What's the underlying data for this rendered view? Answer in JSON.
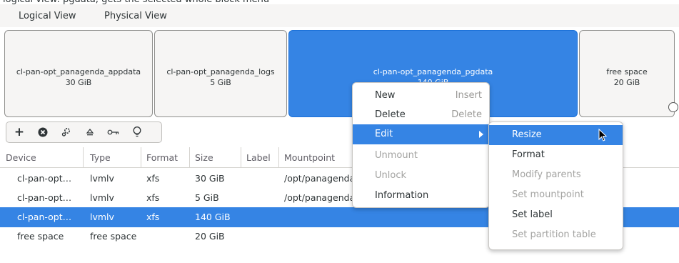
{
  "tabs": [
    {
      "label": "Logical View",
      "active": true
    },
    {
      "label": "Physical View",
      "active": false
    }
  ],
  "blocks": [
    {
      "name": "cl-pan-opt_panagenda_appdata",
      "size": "30 GiB"
    },
    {
      "name": "cl-pan-opt_panagenda_logs",
      "size": "5 GiB"
    },
    {
      "name": "cl-pan-opt_panagenda_pgdata",
      "size": "140 GiB"
    },
    {
      "name": "free space",
      "size": "20 GiB"
    }
  ],
  "toolbar": {
    "add": "+",
    "delete": "✖",
    "configure": "⚙",
    "eject": "⏏",
    "key": "⊶",
    "info": "♀"
  },
  "table": {
    "headers": [
      "Device",
      "Type",
      "Format",
      "Size",
      "Label",
      "Mountpoint"
    ],
    "rows": [
      {
        "device": "cl-pan-opt…",
        "type": "lvmlv",
        "format": "xfs",
        "size": "30 GiB",
        "label": "",
        "mountpoint": "/opt/panagenda"
      },
      {
        "device": "cl-pan-opt…",
        "type": "lvmlv",
        "format": "xfs",
        "size": "5 GiB",
        "label": "",
        "mountpoint": "/opt/panagenda"
      },
      {
        "device": "cl-pan-opt…",
        "type": "lvmlv",
        "format": "xfs",
        "size": "140 GiB",
        "label": "",
        "mountpoint": ""
      },
      {
        "device": "free space",
        "type": "free space",
        "format": "",
        "size": "20 GiB",
        "label": "",
        "mountpoint": ""
      }
    ]
  },
  "context_menu": {
    "items": [
      {
        "label": "New",
        "accel": "Insert"
      },
      {
        "label": "Delete",
        "accel": "Delete"
      },
      {
        "label": "Edit",
        "accel": ""
      },
      {
        "label": "Unmount",
        "accel": ""
      },
      {
        "label": "Unlock",
        "accel": ""
      },
      {
        "label": "Information",
        "accel": ""
      }
    ]
  },
  "submenu": {
    "items": [
      {
        "label": "Resize"
      },
      {
        "label": "Format"
      },
      {
        "label": "Modify parents"
      },
      {
        "label": "Set mountpoint"
      },
      {
        "label": "Set label"
      },
      {
        "label": "Set partition table"
      }
    ]
  },
  "colors": {
    "accent": "#3584e4",
    "disabled_text": "#a3a3a1"
  }
}
